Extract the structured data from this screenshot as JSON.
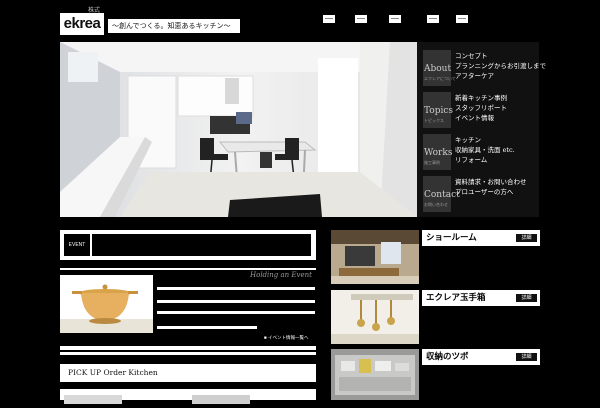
{
  "header": {
    "logo_text": "ekrea",
    "logo_top_text": "株式",
    "tagline": "～創んでつくる。知恵あるキッチン～",
    "nav_count": 5
  },
  "menu": [
    {
      "label": "About",
      "sub": "エクレアについて",
      "lines": [
        "コンセプト",
        "プランニングからお引渡しまで",
        "アフターケア"
      ]
    },
    {
      "label": "Topics",
      "sub": "トピックス",
      "lines": [
        "新着キッチン事例",
        "スタッフリポート",
        "イベント情報"
      ]
    },
    {
      "label": "Works",
      "sub": "施工事例",
      "lines": [
        "キッチン",
        "収納家具・洗面 etc.",
        "リフォーム"
      ]
    },
    {
      "label": "Contact",
      "sub": "お問い合わせ",
      "lines": [
        "資料請求・お問い合わせ",
        "プロユーザーの方へ"
      ]
    }
  ],
  "event": {
    "label": "EVENT",
    "holding": "Holding an Event",
    "link": "■ イベント情報一覧へ"
  },
  "pickup": {
    "label": "PICK UP Order Kitchen"
  },
  "side": [
    {
      "title": "ショールーム",
      "detail": "詳細"
    },
    {
      "title": "エクレア玉手箱",
      "detail": "詳細"
    },
    {
      "title": "収納のツボ",
      "detail": "詳細"
    }
  ],
  "colors": {
    "background": "#000000",
    "panel": "#ffffff",
    "menu_tile": "#333333"
  }
}
